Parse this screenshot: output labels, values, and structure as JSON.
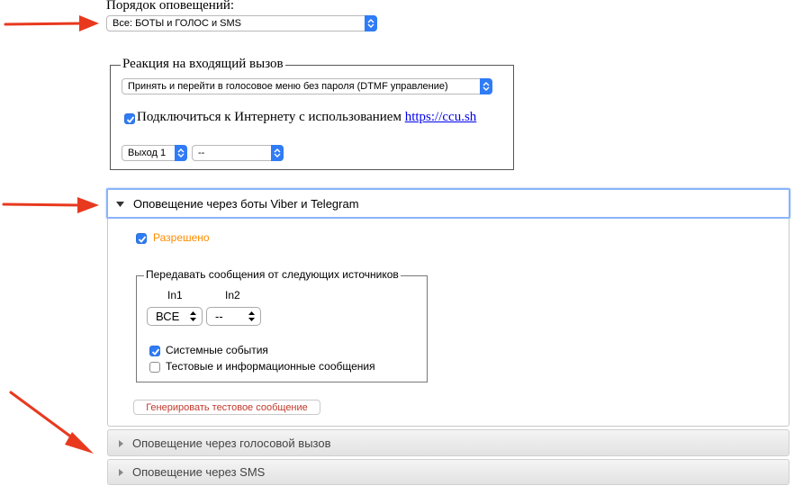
{
  "notify_order": {
    "label": "Порядок оповещений:",
    "selected": "Все: БОТЫ и ГОЛОС и SMS"
  },
  "incoming_call": {
    "legend": "Реакция на входящий вызов",
    "action_selected": "Принять и перейти в голосовое меню без пароля (DTMF управление)",
    "internet_checkbox_label": "Подключиться к Интернету с использованием",
    "internet_link": "https://ccu.sh",
    "internet_checked": true,
    "output_selected": "Выход 1",
    "output_state_selected": "--"
  },
  "bots_section": {
    "header": "Оповещение через боты Viber и Telegram",
    "enabled_label": "Разрешено",
    "enabled_checked": true,
    "sources": {
      "legend": "Передавать сообщения от следующих источников",
      "in1_label": "In1",
      "in2_label": "In2",
      "in1_selected": "ВСЕ",
      "in2_selected": "--",
      "system_events_label": "Системные события",
      "system_events_checked": true,
      "test_messages_label": "Тестовые и информационные сообщения",
      "test_messages_checked": false
    },
    "generate_button": "Генерировать тестовое сообщение"
  },
  "voice_section": {
    "header": "Оповещение через голосовой вызов"
  },
  "sms_section": {
    "header": "Оповещение через SMS"
  },
  "colors": {
    "accent_blue": "#2f7cf6",
    "enabled_orange": "#ff8c00",
    "annotation_red": "#e8391f",
    "link_blue": "#0000ee"
  }
}
